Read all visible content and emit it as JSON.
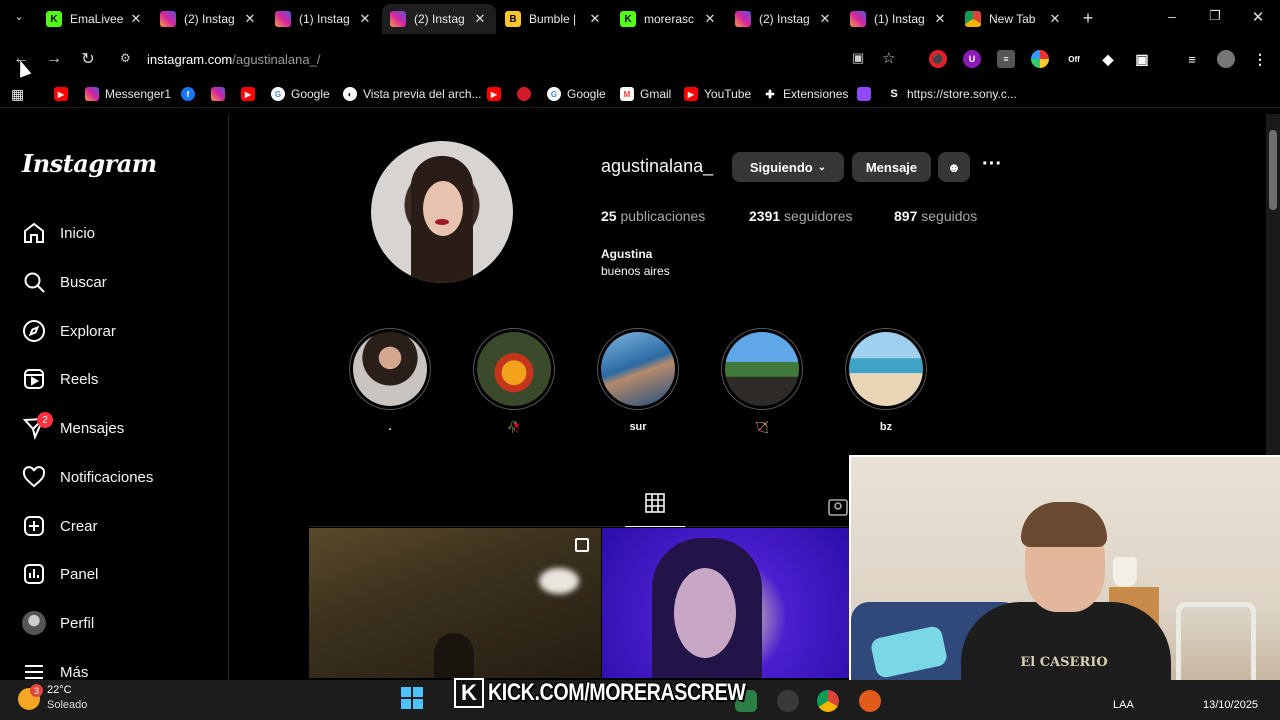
{
  "browser": {
    "tabs": [
      {
        "label": "EmaLivee",
        "favicon": "kick-icon",
        "active": false
      },
      {
        "label": "(2) Instag",
        "favicon": "instagram-icon",
        "active": false
      },
      {
        "label": "(1) Instag",
        "favicon": "instagram-icon",
        "active": false
      },
      {
        "label": "(2) Instag",
        "favicon": "instagram-icon",
        "active": true
      },
      {
        "label": "Bumble | ",
        "favicon": "bumble-icon",
        "active": false
      },
      {
        "label": "morerasc",
        "favicon": "kick-icon",
        "active": false
      },
      {
        "label": "(2) Instag",
        "favicon": "instagram-icon",
        "active": false
      },
      {
        "label": "(1) Instag",
        "favicon": "instagram-icon",
        "active": false
      },
      {
        "label": "New Tab",
        "favicon": "chrome-icon",
        "active": false
      }
    ],
    "url_host": "instagram.com",
    "url_path": "/agustinalana_/",
    "bookmarks": [
      {
        "label": "",
        "icon": "youtube-icon"
      },
      {
        "label": "Messenger1",
        "icon": "instagram-icon"
      },
      {
        "label": "",
        "icon": "facebook-icon"
      },
      {
        "label": "",
        "icon": "instagram-icon"
      },
      {
        "label": "",
        "icon": "youtube-icon"
      },
      {
        "label": "Google",
        "icon": "google-icon"
      },
      {
        "label": "Vista previa del arch...",
        "icon": "preview-icon"
      },
      {
        "label": "",
        "icon": "youtube-icon"
      },
      {
        "label": "",
        "icon": "app-icon"
      },
      {
        "label": "Google",
        "icon": "google-icon"
      },
      {
        "label": "Gmail",
        "icon": "gmail-icon"
      },
      {
        "label": "YouTube",
        "icon": "youtube-icon"
      },
      {
        "label": "Extensiones",
        "icon": "puzzle-icon"
      },
      {
        "label": "",
        "icon": "twitch-icon"
      },
      {
        "label": "https://store.sony.c...",
        "icon": "sony-icon"
      }
    ]
  },
  "instagram": {
    "logo": "Instagram",
    "nav": [
      {
        "label": "Inicio",
        "icon": "home-icon"
      },
      {
        "label": "Buscar",
        "icon": "search-icon"
      },
      {
        "label": "Explorar",
        "icon": "compass-icon"
      },
      {
        "label": "Reels",
        "icon": "reels-icon"
      },
      {
        "label": "Mensajes",
        "icon": "messenger-icon",
        "badge": "2"
      },
      {
        "label": "Notificaciones",
        "icon": "heart-icon"
      },
      {
        "label": "Crear",
        "icon": "plus-square-icon"
      },
      {
        "label": "Panel",
        "icon": "chart-icon"
      },
      {
        "label": "Perfil",
        "icon": "avatar-icon"
      },
      {
        "label": "Más",
        "icon": "menu-icon"
      }
    ],
    "profile": {
      "username": "agustinalana_",
      "following_button": "Siguiendo",
      "message_button": "Mensaje",
      "posts_count": "25",
      "posts_label": "publicaciones",
      "followers_count": "2391",
      "followers_label": "seguidores",
      "following_count": "897",
      "following_label": "seguidos",
      "full_name": "Agustina",
      "bio": "buenos aires"
    },
    "highlights": [
      {
        "label": "."
      },
      {
        "label": "🥀"
      },
      {
        "label": "sur"
      },
      {
        "label": "🏹"
      },
      {
        "label": "bz"
      }
    ]
  },
  "webcam": {
    "shirt_text": "El CASERIO"
  },
  "taskbar": {
    "temperature": "22°C",
    "weather": "Soleado",
    "weather_badge": "3",
    "kick_text": "KICK.COM/MORERASCREW",
    "language": "LAA",
    "date": "13/10/2025"
  },
  "colors": {
    "instagram_bg": "#000000",
    "button_bg": "#363636",
    "badge_red": "#ff3040",
    "kick_green": "#53fc18"
  }
}
